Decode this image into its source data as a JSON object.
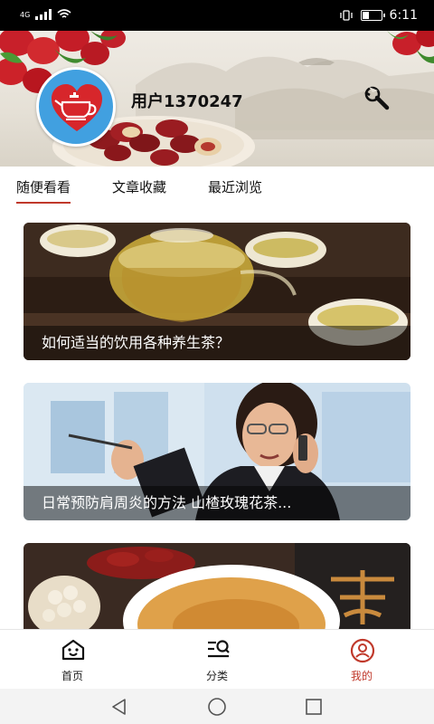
{
  "status_bar": {
    "network": "4G",
    "time": "6:11"
  },
  "profile": {
    "username": "用户1370247"
  },
  "tabs": [
    {
      "label": "随便看看",
      "active": true
    },
    {
      "label": "文章收藏",
      "active": false
    },
    {
      "label": "最近浏览",
      "active": false
    }
  ],
  "articles": [
    {
      "title": "如何适当的饮用各种养生茶？"
    },
    {
      "title": "日常预防肩周炎的方法  山楂玫瑰花茶..."
    },
    {
      "title": ""
    }
  ],
  "bottom_nav": [
    {
      "label": "首页",
      "icon": "home-icon",
      "active": false
    },
    {
      "label": "分类",
      "icon": "category-search-icon",
      "active": false
    },
    {
      "label": "我的",
      "icon": "profile-icon",
      "active": true
    }
  ],
  "colors": {
    "accent": "#c0392b",
    "avatar_bg": "#41a0e0"
  }
}
